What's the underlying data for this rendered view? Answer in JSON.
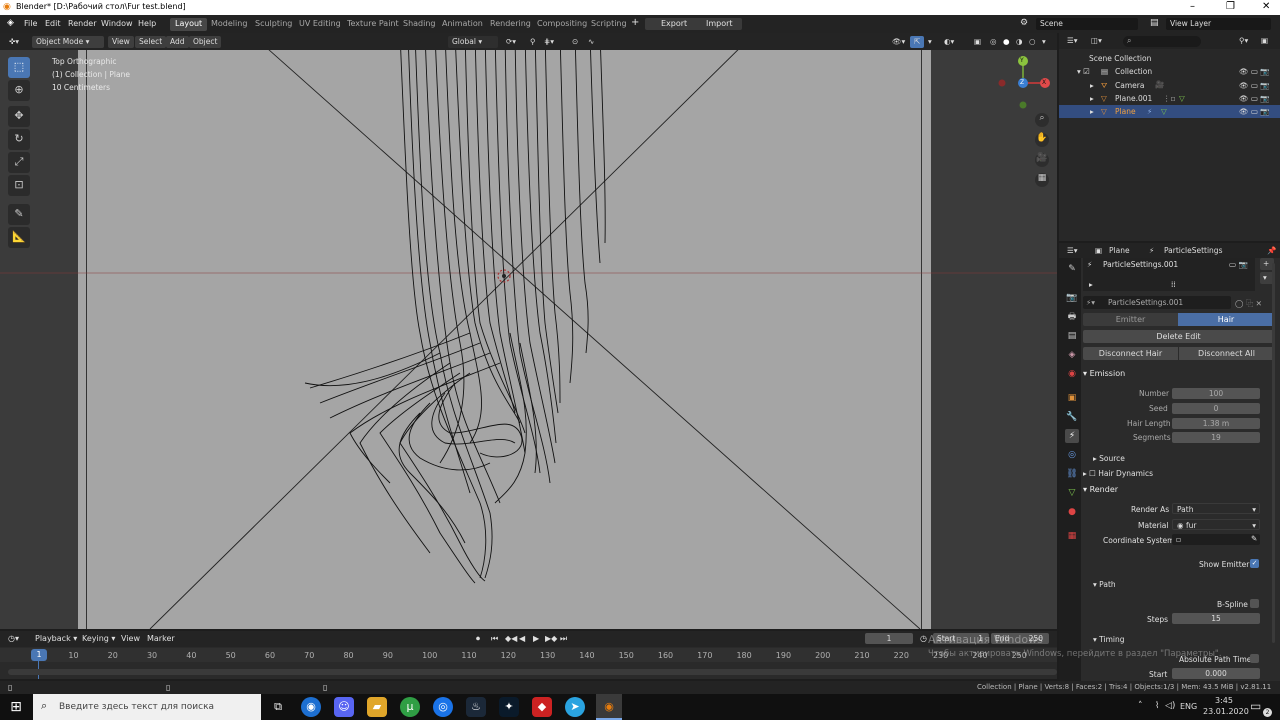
{
  "titlebar": {
    "title": "Blender* [D:\\Рабочий стол\\Fur test.blend]",
    "minimize": "–",
    "maximize": "❐",
    "close": "✕"
  },
  "menu": {
    "items": [
      "File",
      "Edit",
      "Render",
      "Window",
      "Help"
    ],
    "workspaces": [
      "Layout",
      "Modeling",
      "Sculpting",
      "UV Editing",
      "Texture Paint",
      "Shading",
      "Animation",
      "Rendering",
      "Compositing",
      "Scripting"
    ],
    "add_workspace": "+",
    "export": "Export",
    "import": "Import",
    "scene": "Scene",
    "view_layer": "View Layer"
  },
  "viewport_header": {
    "mode": "Object Mode",
    "menus": [
      "View",
      "Select",
      "Add",
      "Object"
    ],
    "orientation": "Global"
  },
  "viewport": {
    "view_name": "Top Orthographic",
    "collection_info": "(1) Collection | Plane",
    "scale": "10 Centimeters",
    "gizmo_x": "X",
    "gizmo_y": "Y",
    "gizmo_z": "Z"
  },
  "outliner": {
    "root": "Scene Collection",
    "collection": "Collection",
    "items": [
      "Camera",
      "Plane.001",
      "Plane"
    ],
    "selected_item": "Plane"
  },
  "properties": {
    "breadcrumb_object": "Plane",
    "breadcrumb_settings": "ParticleSettings",
    "particle_system": "ParticleSettings.001",
    "settings_name": "ParticleSettings.001",
    "type_tabs": [
      "Emitter",
      "Hair"
    ],
    "active_type": "Hair",
    "delete_edit": "Delete Edit",
    "disconnect_hair": "Disconnect Hair",
    "disconnect_all": "Disconnect All",
    "emission": {
      "title": "Emission",
      "number_label": "Number",
      "number": "100",
      "seed_label": "Seed",
      "seed": "0",
      "hair_length_label": "Hair Length",
      "hair_length": "1.38 m",
      "segments_label": "Segments",
      "segments": "19"
    },
    "source": "Source",
    "hair_dynamics": "Hair Dynamics",
    "render": {
      "title": "Render",
      "render_as_label": "Render As",
      "render_as": "Path",
      "material_label": "Material",
      "material": "fur",
      "coord_label": "Coordinate System",
      "show_emitter": "Show Emitter"
    },
    "path": {
      "title": "Path",
      "bspline": "B-Spline",
      "steps_label": "Steps",
      "steps": "15"
    },
    "timing": {
      "title": "Timing",
      "absolute_path_time": "Absolute Path Time",
      "start_label": "Start",
      "start": "0.000"
    }
  },
  "timeline": {
    "menus": [
      "Playback",
      "Keying",
      "View",
      "Marker"
    ],
    "current_frame": "1",
    "start_label": "Start",
    "start": "1",
    "end_label": "End",
    "end": "250",
    "ticks": [
      "10",
      "20",
      "30",
      "40",
      "50",
      "60",
      "70",
      "80",
      "90",
      "100",
      "110",
      "120",
      "130",
      "140",
      "150",
      "160",
      "170",
      "180",
      "190",
      "200",
      "210",
      "220",
      "230",
      "240",
      "250"
    ],
    "playhead": "1"
  },
  "watermark": {
    "line1": "Активация Windows",
    "line2": "Чтобы активировать Windows, перейдите в раздел \"Параметры\"."
  },
  "statusbar": {
    "text": "Collection | Plane | Verts:8 | Faces:2 | Tris:4 | Objects:1/3 | Mem: 43.5 MiB | v2.81.11"
  },
  "taskbar": {
    "search_placeholder": "Введите здесь текст для поиска",
    "lang": "ENG",
    "time": "3:45",
    "date": "23.01.2020",
    "notification_count": "2"
  }
}
